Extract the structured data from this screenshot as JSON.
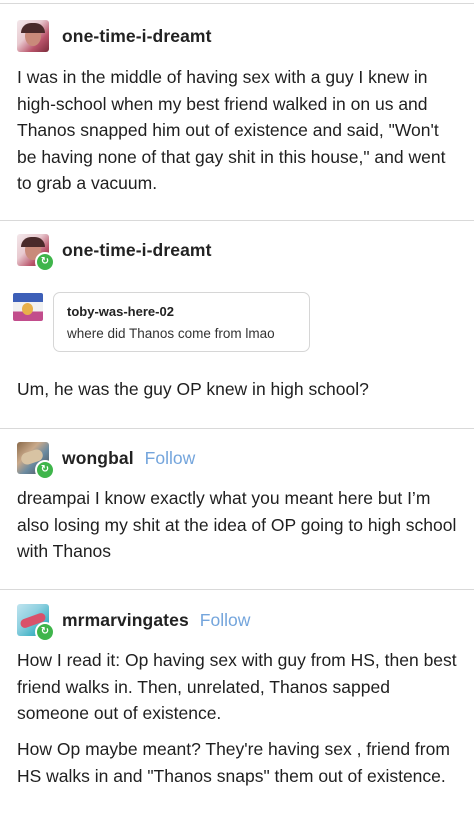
{
  "posts": [
    {
      "username": "one-time-i-dreamt",
      "text": "I was in the middle of having sex with a guy I knew in high-school when my best friend walked in on us and Thanos snapped him out of existence and said, \"Won't be having none of that gay shit in this house,\" and went to grab a vacuum."
    },
    {
      "username": "one-time-i-dreamt",
      "reblog_badge": "↻",
      "quote": {
        "username": "toby-was-here-02",
        "text": "where did Thanos come from lmao"
      },
      "text": "Um, he was the guy OP knew in high school?"
    },
    {
      "username": "wongbal",
      "follow_label": "Follow",
      "reblog_badge": "↻",
      "text": "dreampai I know exactly what you meant here but I’m also losing my shit at the idea of OP going to high school with Thanos"
    },
    {
      "username": "mrmarvingates",
      "follow_label": "Follow",
      "reblog_badge": "↻",
      "text": "How I read it: Op having sex with guy from HS, then best friend walks in. Then, unrelated, Thanos sapped someone out of existence.",
      "text2": "How Op maybe meant? They're having sex , friend from HS walks in and \"Thanos snaps\" them out of existence."
    }
  ],
  "colors": {
    "follow": "#74a5dc",
    "reblog_badge": "#3fb54b",
    "separator": "#d9d9d9"
  }
}
